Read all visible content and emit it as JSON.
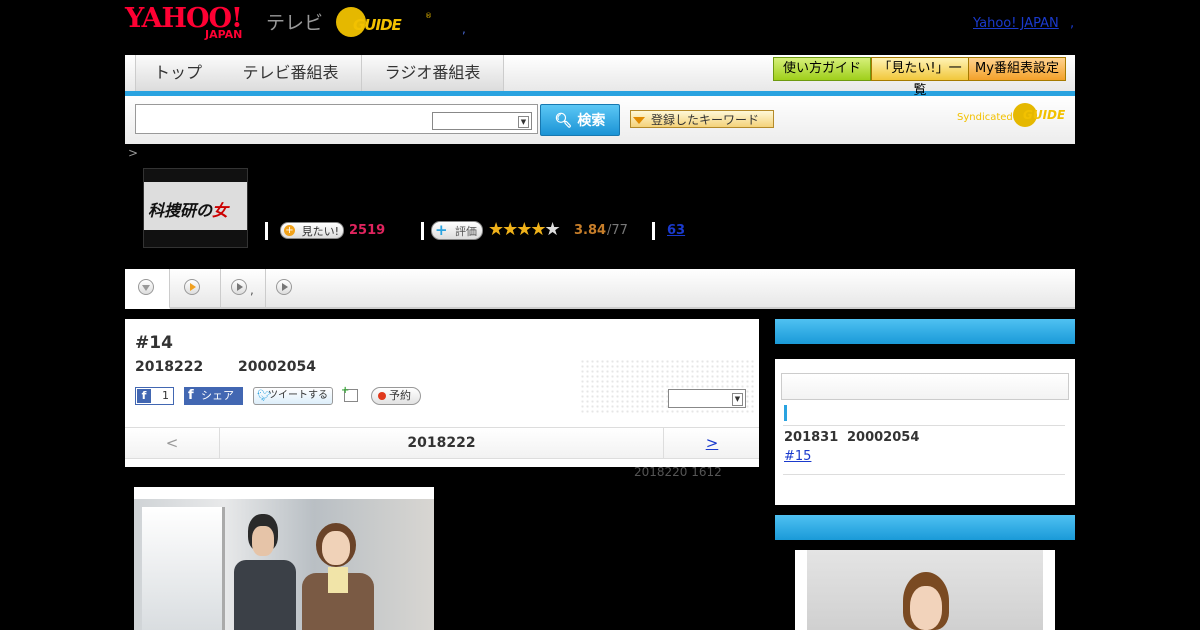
{
  "header": {
    "logo_yahoo": "YAHOO!",
    "logo_japan": "JAPAN",
    "logo_tv": "テレビ",
    "logo_gguide": "GUIDE",
    "logo_reg": "®",
    "comma": ",",
    "yahoo_japan_link": "Yahoo! JAPAN",
    "yahoo_japan_comma": ","
  },
  "nav": {
    "tabs": [
      "トップ",
      "テレビ番組表",
      "ラジオ番組表"
    ],
    "buttons": [
      "使い方ガイド",
      "「見たい!」一覧",
      "My番組表設定"
    ]
  },
  "search": {
    "input_value": "",
    "select_value": "",
    "button_label": "検索",
    "keyword_button": "登録したキーワード",
    "syndicated": "Syndicated",
    "syndicated_guide": "GUIDE"
  },
  "breadcrumb": {
    "separator": ">"
  },
  "program": {
    "logo_text": "科捜研の",
    "logo_accent": "女",
    "mitai_label": "見たい!",
    "mitai_count": "2519",
    "rating_label": "評価",
    "rating_stars_full": "★★★★",
    "rating_stars_empty": "★",
    "rating_value": 3.84,
    "rating_score": "3.84",
    "rating_total": "/77",
    "review_count": "63"
  },
  "subtabs": {
    "comma": ","
  },
  "episode": {
    "number": "#14",
    "date": "2018222",
    "time": "20002054",
    "fb_like_count": "1",
    "fb_share": "シェア",
    "tweet": "ツイートする",
    "reserve": "予約",
    "select_value": "",
    "pager_prev": "<",
    "pager_date": "2018222",
    "pager_next": ">",
    "update_info": "2018220  1612"
  },
  "sidebar": {
    "next_date": "201831",
    "next_time": "20002054",
    "next_episode": "#15"
  },
  "colors": {
    "accent_blue": "#2aa3e0",
    "mitai_pink": "#e0245e",
    "rating_orange": "#c77e2a",
    "link_blue": "#1a3acd"
  },
  "icons": [
    "search-icon",
    "plus-icon",
    "star-icon",
    "play-circle-icon",
    "facebook-icon",
    "twitter-bird-icon",
    "calendar-add-icon",
    "record-dot-icon",
    "dropdown-arrow-icon"
  ]
}
